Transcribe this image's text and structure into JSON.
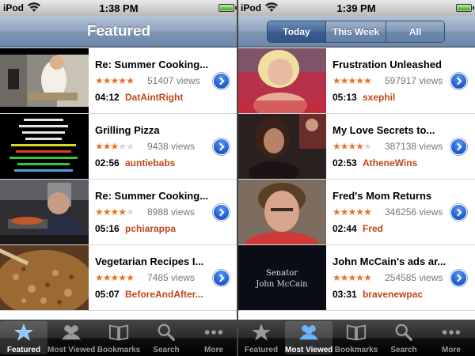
{
  "left": {
    "status": {
      "carrier": "iPod",
      "time": "1:38 PM"
    },
    "nav": {
      "title": "Featured"
    },
    "videos": [
      {
        "title": "Re: Summer Cooking...",
        "stars": 5,
        "views": "51407 views",
        "duration": "04:12",
        "user": "DatAintRight"
      },
      {
        "title": "Grilling Pizza",
        "stars": 3,
        "views": "9438 views",
        "duration": "02:56",
        "user": "auntiebabs"
      },
      {
        "title": "Re: Summer Cooking...",
        "stars": 4,
        "views": "8988 views",
        "duration": "05:16",
        "user": "pchiarappa"
      },
      {
        "title": "Vegetarian Recipes I...",
        "stars": 5,
        "views": "7485 views",
        "duration": "05:07",
        "user": "BeforeAndAfter..."
      }
    ],
    "selected_tab": 0
  },
  "right": {
    "status": {
      "carrier": "iPod",
      "time": "1:39 PM"
    },
    "segments": [
      "Today",
      "This Week",
      "All"
    ],
    "selected_segment": 0,
    "videos": [
      {
        "title": "Frustration Unleashed",
        "stars": 5,
        "views": "597917 views",
        "duration": "05:13",
        "user": "sxephil"
      },
      {
        "title": "My Love Secrets to...",
        "stars": 4,
        "views": "387138 views",
        "duration": "02:53",
        "user": "AtheneWins"
      },
      {
        "title": "Fred's Mom Returns",
        "stars": 5,
        "views": "346256 views",
        "duration": "02:44",
        "user": "Fred"
      },
      {
        "title": "John McCain's ads ar...",
        "stars": 5,
        "views": "254585 views",
        "duration": "03:31",
        "user": "bravenewpac"
      }
    ],
    "selected_tab": 1,
    "thumb_caption": {
      "line1": "Senator",
      "line2": "John McCain"
    }
  },
  "tabs": [
    {
      "label": "Featured",
      "icon": "featured-star-icon"
    },
    {
      "label": "Most Viewed",
      "icon": "most-viewed-people-icon"
    },
    {
      "label": "Bookmarks",
      "icon": "bookmarks-book-icon"
    },
    {
      "label": "Search",
      "icon": "search-icon"
    },
    {
      "label": "More",
      "icon": "more-dots-icon"
    }
  ],
  "colors": {
    "accent_orange": "#e8722a",
    "username": "#c0461a",
    "disclosure_blue": "#2360d3",
    "navbar": "#7f96b4"
  }
}
